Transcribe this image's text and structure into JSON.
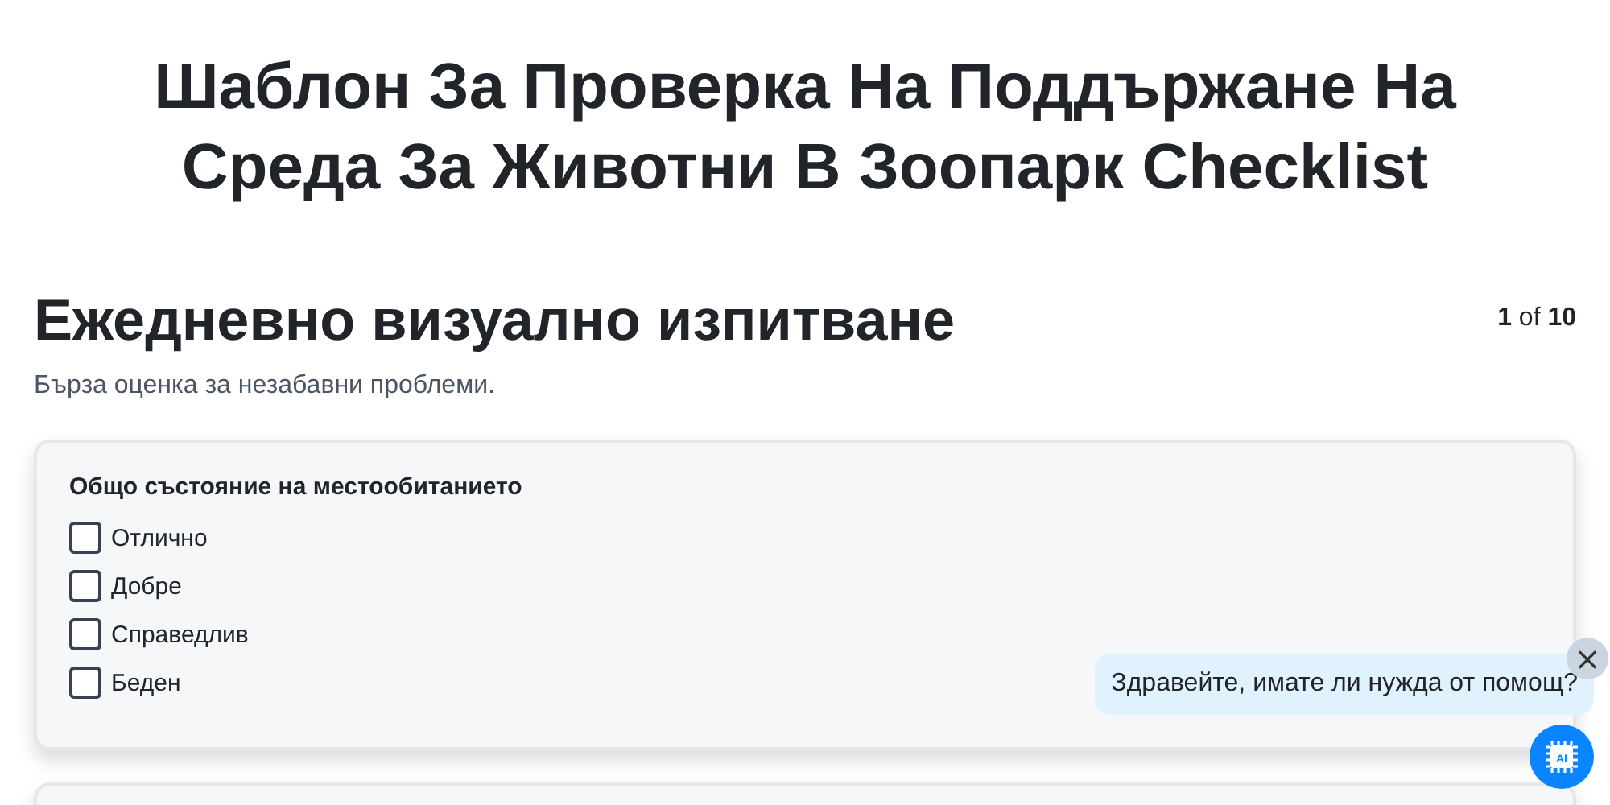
{
  "title": "Шаблон За Проверка На Поддържане На Среда За Животни В Зоопарк Checklist",
  "section": {
    "heading": "Ежедневно визуално изпитване",
    "counter": "**1** of **10**",
    "description": "Бърза оценка за незабавни проблеми."
  },
  "question": {
    "label": "Общо състояние на местообитанието",
    "options": [
      {
        "label": "Отлично",
        "checked": false
      },
      {
        "label": "Добре",
        "checked": false
      },
      {
        "label": "Справедлив",
        "checked": false
      },
      {
        "label": "Беден",
        "checked": false
      }
    ]
  },
  "chat": {
    "message": "Здравейте, имате ли нужда от помощ?",
    "close": "×",
    "button_label": "AI"
  }
}
